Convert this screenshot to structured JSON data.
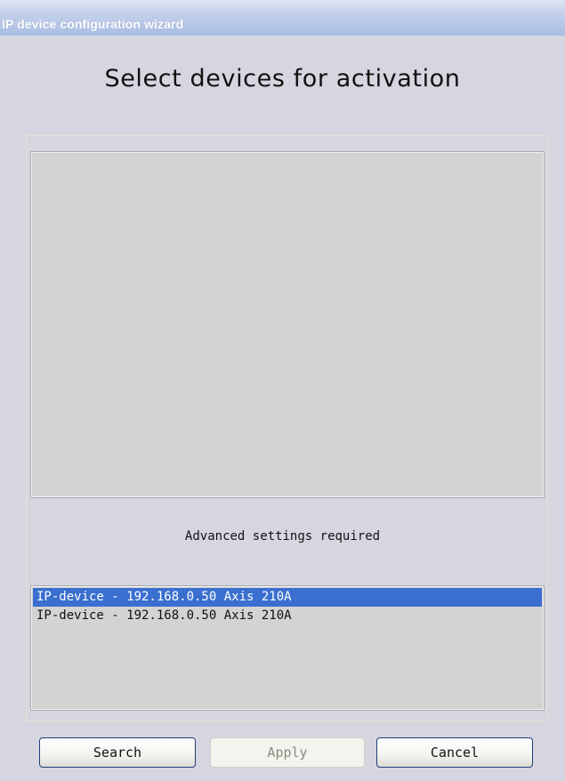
{
  "window": {
    "title": "IP device configuration wizard"
  },
  "heading": "Select devices for activation",
  "status_text": "Advanced settings required",
  "devices": [
    {
      "label": "IP-device - 192.168.0.50 Axis 210A",
      "selected": true
    },
    {
      "label": "IP-device - 192.168.0.50 Axis 210A",
      "selected": false
    }
  ],
  "buttons": {
    "search": {
      "label": "Search",
      "enabled": true
    },
    "apply": {
      "label": "Apply",
      "enabled": false
    },
    "cancel": {
      "label": "Cancel",
      "enabled": true
    }
  },
  "colors": {
    "selection": "#3a6fd0",
    "window_background": "#d5d6df",
    "panel_background": "#d3d3d3"
  }
}
